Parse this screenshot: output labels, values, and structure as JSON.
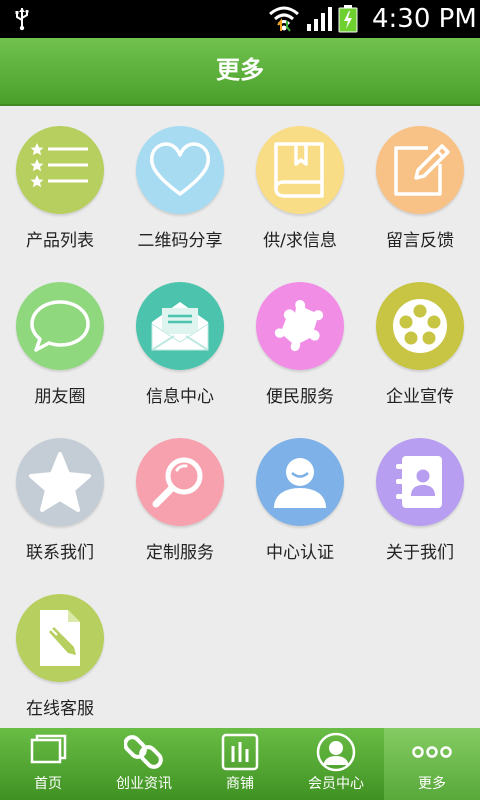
{
  "status_bar": {
    "time": "4:30 PM",
    "icons": [
      "usb-icon",
      "wifi-icon",
      "signal-icon",
      "battery-charging-icon"
    ]
  },
  "header": {
    "title": "更多"
  },
  "grid": {
    "items": [
      {
        "label": "产品列表",
        "icon": "product-list-icon",
        "color": "#b7cf5f"
      },
      {
        "label": "二维码分享",
        "icon": "heart-icon",
        "color": "#a6dbf2"
      },
      {
        "label": "供/求信息",
        "icon": "book-icon",
        "color": "#f9dd86"
      },
      {
        "label": "留言反馈",
        "icon": "edit-icon",
        "color": "#f8c185"
      },
      {
        "label": "朋友圈",
        "icon": "chat-bubble-icon",
        "color": "#8fd87e"
      },
      {
        "label": "信息中心",
        "icon": "envelope-icon",
        "color": "#4cc3ac"
      },
      {
        "label": "便民服务",
        "icon": "puzzle-icon",
        "color": "#f18de5"
      },
      {
        "label": "企业宣传",
        "icon": "film-reel-icon",
        "color": "#c8c544"
      },
      {
        "label": "联系我们",
        "icon": "star-icon",
        "color": "#c4ccd6"
      },
      {
        "label": "定制服务",
        "icon": "magnifier-icon",
        "color": "#f7a1ae"
      },
      {
        "label": "中心认证",
        "icon": "user-icon",
        "color": "#7db1e7"
      },
      {
        "label": "关于我们",
        "icon": "contacts-book-icon",
        "color": "#b79ef0"
      },
      {
        "label": "在线客服",
        "icon": "document-edit-icon",
        "color": "#b7cf5f"
      }
    ]
  },
  "tabbar": {
    "items": [
      {
        "label": "首页",
        "icon": "home-pages-icon"
      },
      {
        "label": "创业资讯",
        "icon": "link-icon"
      },
      {
        "label": "商铺",
        "icon": "bar-chart-icon"
      },
      {
        "label": "会员中心",
        "icon": "member-icon"
      },
      {
        "label": "更多",
        "icon": "more-dots-icon",
        "active": true
      }
    ]
  }
}
